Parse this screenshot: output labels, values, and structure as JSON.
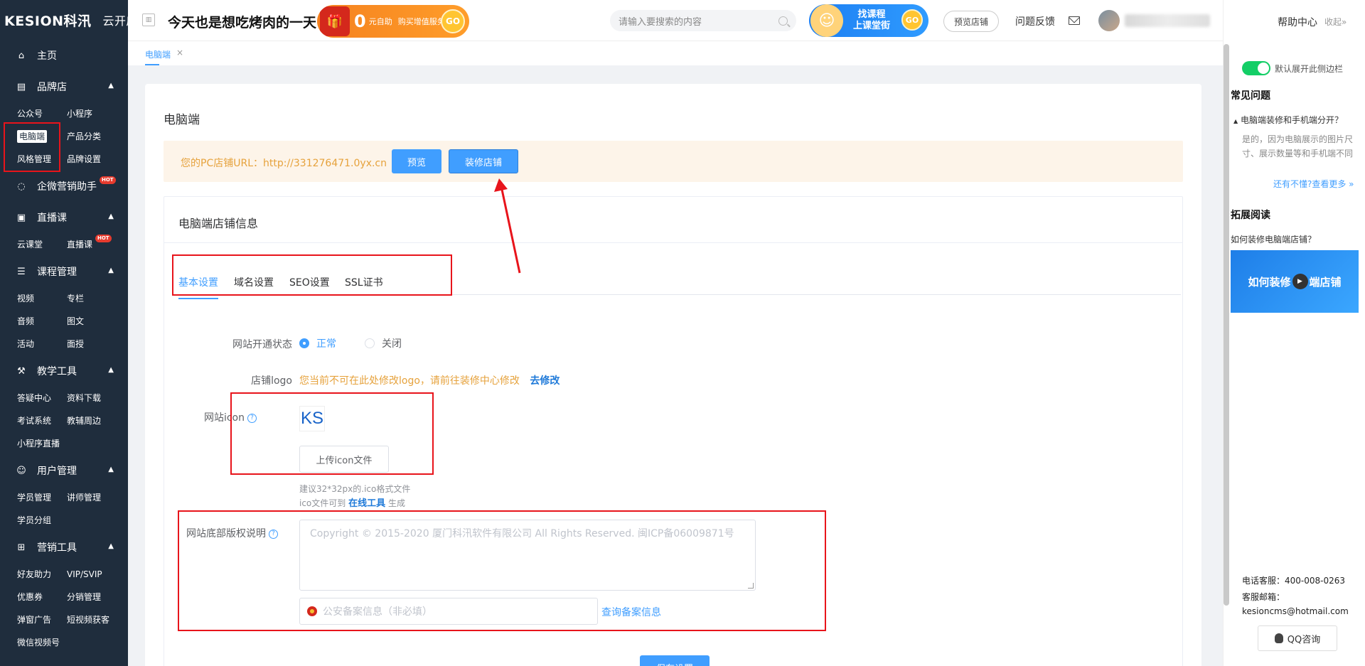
{
  "brand": {
    "logo": "KESION科汛",
    "suffix": "云开店"
  },
  "sidebar": {
    "home": "主页",
    "groups": [
      {
        "title": "品牌店",
        "icon": "store-icon",
        "items": [
          "公众号",
          "小程序",
          "电脑端",
          "产品分类",
          "风格管理",
          "品牌设置"
        ],
        "active": "电脑端"
      },
      {
        "title": "企微营销助手",
        "icon": "chat-icon",
        "hot": "HOT",
        "items": []
      },
      {
        "title": "直播课",
        "icon": "camera-icon",
        "items": [
          "云课堂",
          "直播课"
        ],
        "hot_item": "HOT"
      },
      {
        "title": "课程管理",
        "icon": "list-icon",
        "items": [
          "视频",
          "专栏",
          "音频",
          "图文",
          "活动",
          "面授"
        ]
      },
      {
        "title": "教学工具",
        "icon": "tools-icon",
        "items": [
          "答疑中心",
          "资料下载",
          "考试系统",
          "教辅周边",
          "小程序直播"
        ]
      },
      {
        "title": "用户管理",
        "icon": "user-icon",
        "items": [
          "学员管理",
          "讲师管理",
          "学员分组"
        ]
      },
      {
        "title": "营销工具",
        "icon": "gift-icon",
        "items": [
          "好友助力",
          "VIP/SVIP",
          "优惠券",
          "分销管理",
          "弹窗广告",
          "短视频获客",
          "微信视频号"
        ]
      }
    ]
  },
  "header": {
    "shop_title": "今天也是想吃烤肉的一天",
    "promo1": {
      "big": "0",
      "line1": "元自助",
      "line2": "购买增值服务",
      "go": "GO"
    },
    "search_placeholder": "请输入要搜索的内容",
    "promo2": {
      "line1": "找课程",
      "line2": "上课堂街",
      "go": "GO"
    },
    "preview_shop": "预览店铺",
    "feedback": "问题反馈"
  },
  "tabstrip": {
    "tab": "电脑端",
    "close": "×"
  },
  "main": {
    "title": "电脑端",
    "url_label": "您的PC店铺URL：http://331276471.0yx.cn",
    "preview_btn": "预览",
    "decorate_btn": "装修店铺",
    "info_title": "电脑端店铺信息",
    "tabs": [
      "基本设置",
      "域名设置",
      "SEO设置",
      "SSL证书"
    ],
    "active_tab": "基本设置",
    "site_status_label": "网站开通状态",
    "status_on": "正常",
    "status_off": "关闭",
    "status_value": "正常",
    "logo_label": "店铺logo",
    "logo_note": "您当前不可在此处修改logo，请前往装修中心修改",
    "logo_link": "去修改",
    "icon_label": "网站icon",
    "icon_preview": "KS",
    "upload_btn": "上传icon文件",
    "icon_hint1": "建议32*32px的.ico格式文件",
    "icon_hint2_pre": "ico文件可到",
    "icon_hint2_link": "在线工具",
    "icon_hint2_post": "生成",
    "copyright_label": "网站底部版权说明",
    "copyright_placeholder": "Copyright © 2015-2020 厦门科汛软件有限公司 All Rights Reserved. 闽ICP备06009871号",
    "police_placeholder": "公安备案信息（非必填）",
    "police_query": "查询备案信息",
    "save_btn": "保存设置"
  },
  "right_panel": {
    "help": "帮助中心",
    "collapse": "收起»",
    "switch_label": "默认展开此侧边栏",
    "faq_title": "常见问题",
    "faq_q": "电脑端装修和手机端分开？",
    "faq_a": "是的，因为电脑展示的图片尺寸、展示数量等和手机端不同",
    "faq_more": "还有不懂?查看更多 »",
    "read_title": "拓展阅读",
    "read_item": "如何装修电脑端店铺？",
    "video_text_left": "如何装修",
    "video_text_right": "端店铺",
    "phone": "电话客服：400-008-0263",
    "email": "客服邮箱：kesioncms@hotmail.com",
    "qq": "QQ咨询"
  },
  "colors": {
    "sidebar": "#1f2d3d",
    "accent": "#409eff",
    "annotation": "#e8141b",
    "warning": "#e6a23c"
  }
}
